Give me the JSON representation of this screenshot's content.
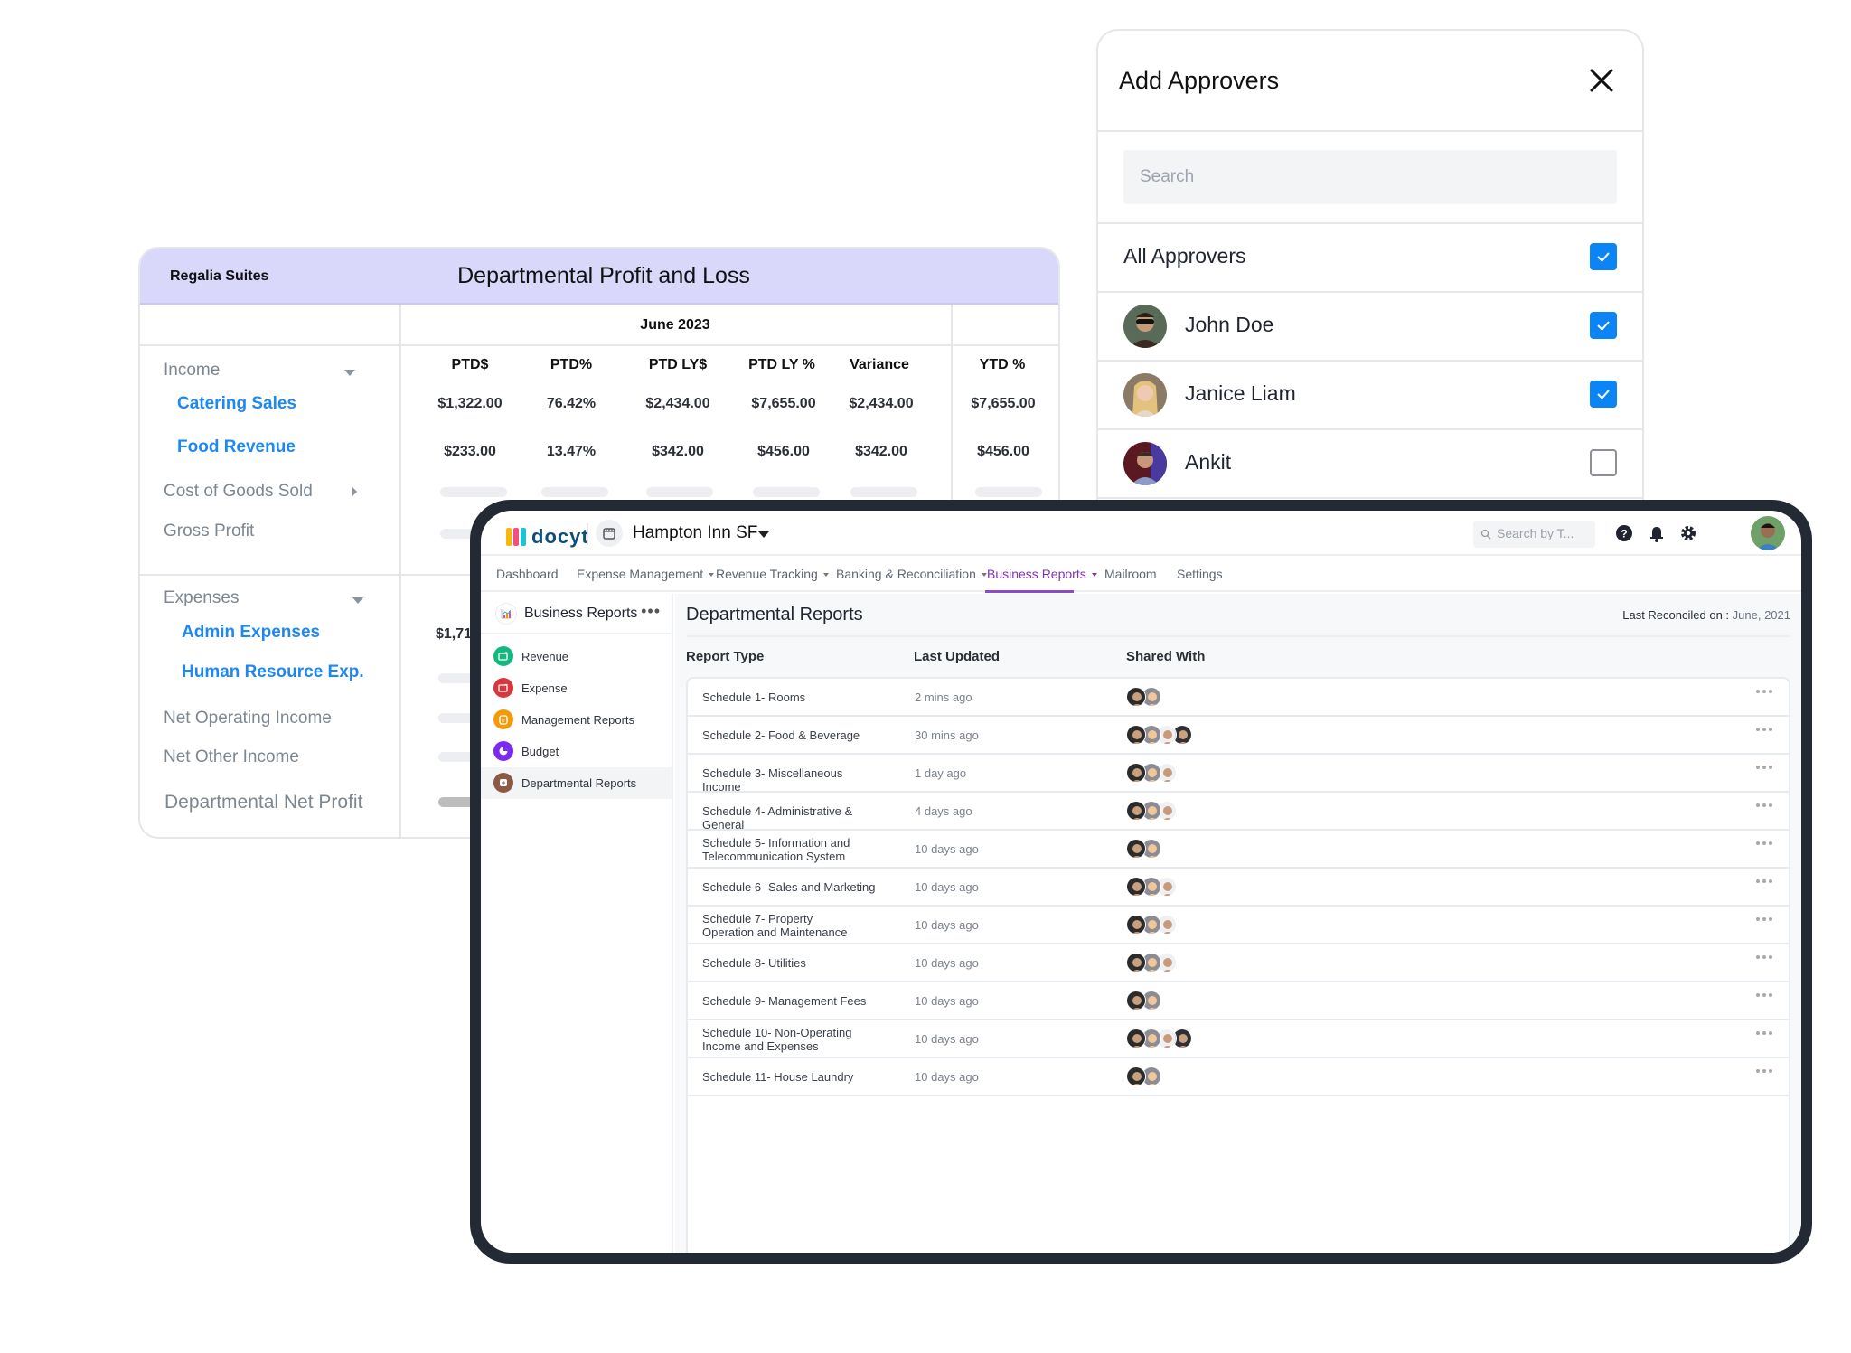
{
  "pl_report": {
    "company": "Regalia Suites",
    "title": "Departmental Profit and Loss",
    "period": "June 2023",
    "columns": [
      "PTD$",
      "PTD%",
      "PTD LY$",
      "PTD LY %",
      "Variance",
      "YTD %"
    ],
    "sections": [
      {
        "label": "Income",
        "expanded": true
      },
      {
        "label": "Expenses",
        "expanded": true
      }
    ],
    "rows": [
      {
        "label": "Income",
        "type": "section",
        "values": []
      },
      {
        "label": "Catering Sales",
        "type": "sub",
        "values": [
          "$1,322.00",
          "76.42%",
          "$2,434.00",
          "$7,655.00",
          "$2,434.00",
          "$7,655.00"
        ]
      },
      {
        "label": "Food Revenue",
        "type": "sub",
        "values": [
          "$233.00",
          "13.47%",
          "$342.00",
          "$456.00",
          "$342.00",
          "$456.00"
        ]
      },
      {
        "label": "Cost of Goods Sold",
        "type": "collapsed",
        "values": []
      },
      {
        "label": "Gross Profit",
        "type": "total",
        "values": []
      },
      {
        "label": "Expenses",
        "type": "section",
        "values": []
      },
      {
        "label": "Admin Expenses",
        "type": "sub",
        "values": [
          "$1,71"
        ]
      },
      {
        "label": "Human Resource Exp.",
        "type": "sub",
        "values": []
      },
      {
        "label": "Net Operating Income",
        "type": "total",
        "values": []
      },
      {
        "label": "Net Other Income",
        "type": "total",
        "values": []
      },
      {
        "label": "Departmental Net Profit",
        "type": "total",
        "values": []
      }
    ]
  },
  "approvers_dialog": {
    "title": "Add Approvers",
    "close_icon": "close-icon",
    "search_placeholder": "Search",
    "search_value": "",
    "all_label": "All Approvers",
    "all_checked": true,
    "approvers": [
      {
        "name": "John Doe",
        "checked": true
      },
      {
        "name": "Janice Liam",
        "checked": true
      },
      {
        "name": "Ankit",
        "checked": false
      }
    ]
  },
  "app": {
    "logo_text": "docyt",
    "business_name": "Hampton Inn SF",
    "search_placeholder": "Search by T...",
    "top_icons": [
      "help-icon",
      "bell-icon",
      "gear-icon",
      "user-avatar"
    ],
    "nav": [
      {
        "label": "Dashboard",
        "dropdown": false,
        "active": false
      },
      {
        "label": "Expense Management",
        "dropdown": true,
        "active": false
      },
      {
        "label": "Revenue Tracking",
        "dropdown": true,
        "active": false
      },
      {
        "label": "Banking & Reconciliation",
        "dropdown": true,
        "active": false
      },
      {
        "label": "Business Reports",
        "dropdown": true,
        "active": true
      },
      {
        "label": "Mailroom",
        "dropdown": false,
        "active": false
      },
      {
        "label": "Settings",
        "dropdown": false,
        "active": false
      }
    ],
    "sidebar": {
      "title": "Business Reports",
      "more_icon": "more-dots-icon",
      "items": [
        {
          "label": "Revenue",
          "color": "#14b77e",
          "active": false
        },
        {
          "label": "Expense",
          "color": "#d9363e",
          "active": false
        },
        {
          "label": "Management Reports",
          "color": "#f39a0b",
          "active": false
        },
        {
          "label": "Budget",
          "color": "#7b2bf0",
          "active": false
        },
        {
          "label": "Departmental Reports",
          "color": "#8b5a45",
          "active": true
        }
      ]
    },
    "main": {
      "title": "Departmental Reports",
      "reconciled_label": "Last Reconciled on :",
      "reconciled_value": "June, 2021",
      "columns": [
        "Report Type",
        "Last Updated",
        "Shared With"
      ],
      "rows": [
        {
          "name": "Schedule 1- Rooms",
          "updated": "2 mins ago",
          "shared": 2
        },
        {
          "name": "Schedule 2- Food & Beverage",
          "updated": "30 mins ago",
          "shared": 4
        },
        {
          "name": "Schedule 3- Miscellaneous Income",
          "updated": "1 day ago",
          "shared": 3
        },
        {
          "name": "Schedule 4- Administrative & General",
          "updated": "4 days ago",
          "shared": 3
        },
        {
          "name": "Schedule 5- Information and Telecommunication System",
          "updated": "10 days ago",
          "shared": 2
        },
        {
          "name": "Schedule 6- Sales and Marketing",
          "updated": "10 days ago",
          "shared": 3
        },
        {
          "name": "Schedule 7- Property Operation and Maintenance",
          "updated": "10 days ago",
          "shared": 3
        },
        {
          "name": "Schedule 8- Utilities",
          "updated": "10 days ago",
          "shared": 3
        },
        {
          "name": "Schedule 9- Management Fees",
          "updated": "10 days ago",
          "shared": 2
        },
        {
          "name": "Schedule 10- Non-Operating Income and Expenses",
          "updated": "10 days ago",
          "shared": 4
        },
        {
          "name": "Schedule 11- House Laundry",
          "updated": "10 days ago",
          "shared": 2
        }
      ]
    }
  },
  "colors": {
    "pl_header_bg": "#d9d8fb",
    "link_blue": "#1e88f2",
    "checkbox_blue": "#0b84f5",
    "nav_active": "#8134af",
    "device_frame": "#242a33"
  }
}
